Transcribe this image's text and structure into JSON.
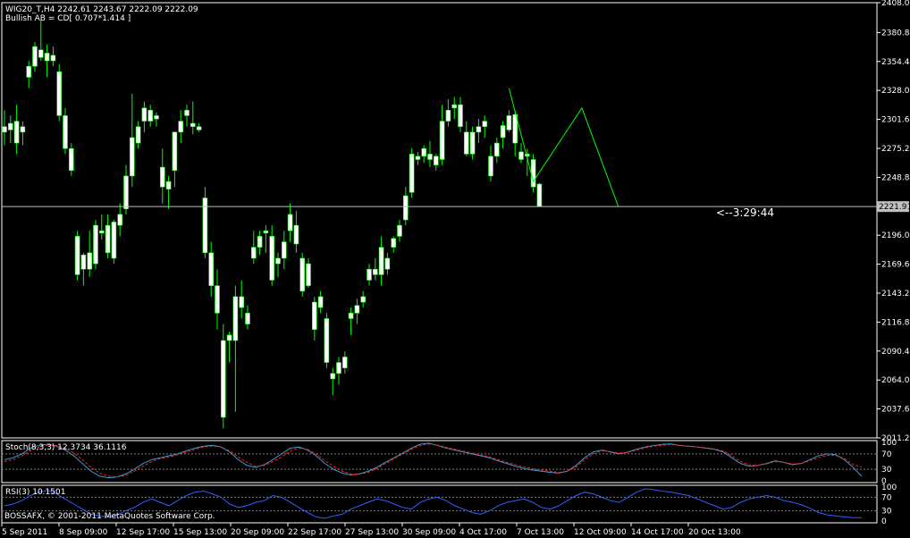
{
  "header": {
    "title": "WIG20_T,H4  2242.61 2243.67 2222.09 2222.09",
    "pattern": "Bullish AB = CD[ 0.707*1.414 ]"
  },
  "countdown": "<--3:29:44",
  "current_price_label": "2221.91",
  "copyright": "BOSSAFX, © 2001-2011 MetaQuotes Software Corp.",
  "colors": {
    "bull": "#ffffff",
    "bear": "#ffffff",
    "wick": "#00ff00",
    "zigzag": "#00ff00",
    "stoch_main": "#3b9bd6",
    "stoch_signal": "#ff2020",
    "rsi": "#3060ff",
    "grid": "#c0c0c0",
    "bg": "#000000"
  },
  "chart_data": [
    {
      "type": "candlestick",
      "title": "WIG20_T,H4",
      "y_ticks": [
        "2408.00",
        "2380.80",
        "2354.40",
        "2328.00",
        "2301.60",
        "2275.20",
        "2248.80",
        "2222.40",
        "2196.00",
        "2169.60",
        "2143.20",
        "2116.80",
        "2090.40",
        "2064.00",
        "2037.60",
        "2011.20"
      ],
      "x_ticks": [
        "5 Sep 2011",
        "8 Sep 09:00",
        "12 Sep 17:00",
        "15 Sep 13:00",
        "20 Sep 09:00",
        "22 Sep 17:00",
        "27 Sep 13:00",
        "30 Sep 09:00",
        "4 Oct 17:00",
        "7 Oct 13:00",
        "12 Oct 09:00",
        "14 Oct 17:00",
        "20 Oct 13:00"
      ],
      "ylim": [
        2011.2,
        2408
      ],
      "current_price": 2222.09,
      "ohlc": [
        [
          2295,
          2310,
          2278,
          2290
        ],
        [
          2292,
          2305,
          2280,
          2298
        ],
        [
          2300,
          2315,
          2270,
          2280
        ],
        [
          2290,
          2300,
          2278,
          2295
        ],
        [
          2340,
          2355,
          2330,
          2350
        ],
        [
          2350,
          2372,
          2345,
          2368
        ],
        [
          2365,
          2392,
          2355,
          2358
        ],
        [
          2355,
          2370,
          2340,
          2362
        ],
        [
          2360,
          2368,
          2350,
          2355
        ],
        [
          2345,
          2352,
          2300,
          2305
        ],
        [
          2305,
          2312,
          2270,
          2275
        ],
        [
          2275,
          2280,
          2250,
          2255
        ],
        [
          2195,
          2200,
          2155,
          2160
        ],
        [
          2165,
          2180,
          2150,
          2178
        ],
        [
          2180,
          2200,
          2158,
          2165
        ],
        [
          2170,
          2210,
          2165,
          2205
        ],
        [
          2198,
          2215,
          2192,
          2200
        ],
        [
          2205,
          2215,
          2175,
          2180
        ],
        [
          2175,
          2210,
          2170,
          2208
        ],
        [
          2205,
          2225,
          2195,
          2215
        ],
        [
          2220,
          2260,
          2215,
          2250
        ],
        [
          2250,
          2325,
          2240,
          2285
        ],
        [
          2280,
          2300,
          2275,
          2295
        ],
        [
          2300,
          2318,
          2290,
          2312
        ],
        [
          2310,
          2315,
          2295,
          2300
        ],
        [
          2302,
          2308,
          2295,
          2305
        ],
        [
          2258,
          2275,
          2225,
          2240
        ],
        [
          2238,
          2250,
          2220,
          2245
        ],
        [
          2255,
          2280,
          2240,
          2290
        ],
        [
          2290,
          2310,
          2280,
          2300
        ],
        [
          2305,
          2315,
          2295,
          2310
        ],
        [
          2298,
          2318,
          2288,
          2295
        ],
        [
          2295,
          2298,
          2290,
          2292
        ],
        [
          2230,
          2240,
          2175,
          2180
        ],
        [
          2180,
          2190,
          2140,
          2150
        ],
        [
          2150,
          2165,
          2110,
          2125
        ],
        [
          2100,
          2115,
          2020,
          2030
        ],
        [
          2100,
          2108,
          2080,
          2105
        ],
        [
          2100,
          2150,
          2035,
          2140
        ],
        [
          2140,
          2155,
          2120,
          2130
        ],
        [
          2125,
          2132,
          2110,
          2115
        ],
        [
          2175,
          2200,
          2170,
          2185
        ],
        [
          2185,
          2200,
          2178,
          2195
        ],
        [
          2198,
          2205,
          2180,
          2200
        ],
        [
          2195,
          2205,
          2150,
          2155
        ],
        [
          2175,
          2180,
          2158,
          2170
        ],
        [
          2175,
          2200,
          2165,
          2190
        ],
        [
          2200,
          2225,
          2190,
          2215
        ],
        [
          2205,
          2218,
          2180,
          2188
        ],
        [
          2175,
          2180,
          2140,
          2145
        ],
        [
          2150,
          2175,
          2148,
          2170
        ],
        [
          2135,
          2140,
          2100,
          2110
        ],
        [
          2140,
          2145,
          2125,
          2130
        ],
        [
          2120,
          2125,
          2075,
          2080
        ],
        [
          2070,
          2075,
          2050,
          2065
        ],
        [
          2080,
          2085,
          2060,
          2070
        ],
        [
          2075,
          2090,
          2070,
          2085
        ],
        [
          2120,
          2130,
          2105,
          2125
        ],
        [
          2125,
          2138,
          2115,
          2132
        ],
        [
          2135,
          2145,
          2130,
          2140
        ],
        [
          2155,
          2170,
          2150,
          2165
        ],
        [
          2165,
          2175,
          2155,
          2160
        ],
        [
          2185,
          2195,
          2150,
          2160
        ],
        [
          2165,
          2180,
          2160,
          2175
        ],
        [
          2185,
          2195,
          2180,
          2193
        ],
        [
          2195,
          2210,
          2190,
          2205
        ],
        [
          2210,
          2240,
          2205,
          2232
        ],
        [
          2235,
          2275,
          2230,
          2270
        ],
        [
          2265,
          2272,
          2260,
          2268
        ],
        [
          2268,
          2278,
          2262,
          2275
        ],
        [
          2270,
          2282,
          2258,
          2265
        ],
        [
          2260,
          2270,
          2255,
          2268
        ],
        [
          2265,
          2315,
          2260,
          2300
        ],
        [
          2300,
          2320,
          2295,
          2310
        ],
        [
          2312,
          2322,
          2302,
          2315
        ],
        [
          2315,
          2322,
          2290,
          2295
        ],
        [
          2290,
          2300,
          2268,
          2270
        ],
        [
          2270,
          2295,
          2265,
          2290
        ],
        [
          2290,
          2302,
          2280,
          2295
        ],
        [
          2295,
          2305,
          2285,
          2300
        ],
        [
          2268,
          2278,
          2245,
          2250
        ],
        [
          2268,
          2285,
          2262,
          2280
        ],
        [
          2285,
          2300,
          2275,
          2296
        ],
        [
          2292,
          2310,
          2290,
          2305
        ],
        [
          2306,
          2310,
          2268,
          2280
        ],
        [
          2272,
          2280,
          2262,
          2265
        ],
        [
          2268,
          2275,
          2250,
          2270
        ],
        [
          2265,
          2270,
          2235,
          2240
        ],
        [
          2242.61,
          2243.67,
          2222.09,
          2222.09
        ]
      ],
      "zigzag": [
        [
          83,
          2330
        ],
        [
          87,
          2245
        ],
        [
          95,
          2312
        ],
        [
          101,
          2222
        ]
      ]
    },
    {
      "type": "line",
      "title": "Stoch(8,3,3) 12.3734 36.1116",
      "y_ticks": [
        "100",
        "70",
        "30",
        "0"
      ],
      "ylim": [
        0,
        100
      ],
      "series": [
        {
          "name": "main",
          "values": [
            55,
            60,
            70,
            85,
            92,
            95,
            90,
            80,
            65,
            45,
            25,
            12,
            8,
            10,
            18,
            30,
            45,
            55,
            60,
            65,
            70,
            78,
            85,
            90,
            92,
            88,
            75,
            55,
            40,
            35,
            42,
            55,
            70,
            85,
            88,
            80,
            65,
            45,
            30,
            20,
            15,
            18,
            25,
            35,
            48,
            60,
            72,
            85,
            95,
            98,
            92,
            85,
            80,
            75,
            70,
            65,
            60,
            52,
            45,
            38,
            32,
            28,
            25,
            22,
            20,
            25,
            40,
            60,
            75,
            80,
            75,
            70,
            75,
            82,
            88,
            92,
            95,
            96,
            92,
            90,
            88,
            85,
            82,
            75,
            60,
            45,
            38,
            40,
            45,
            52,
            48,
            42,
            45,
            55,
            65,
            70,
            68,
            55,
            35,
            12
          ]
        },
        {
          "name": "signal",
          "values": [
            50,
            55,
            65,
            78,
            88,
            93,
            92,
            85,
            72,
            55,
            35,
            20,
            12,
            10,
            14,
            25,
            38,
            50,
            58,
            62,
            68,
            75,
            82,
            88,
            90,
            88,
            78,
            62,
            48,
            38,
            40,
            50,
            62,
            78,
            85,
            82,
            70,
            52,
            38,
            25,
            18,
            17,
            22,
            32,
            45,
            58,
            70,
            82,
            92,
            96,
            93,
            87,
            82,
            77,
            72,
            67,
            62,
            55,
            48,
            42,
            36,
            31,
            28,
            25,
            22,
            25,
            36,
            55,
            70,
            78,
            76,
            72,
            74,
            80,
            86,
            90,
            93,
            94,
            92,
            90,
            88,
            86,
            83,
            78,
            65,
            50,
            42,
            40,
            44,
            50,
            48,
            44,
            45,
            52,
            60,
            66,
            66,
            58,
            42,
            36
          ]
        }
      ]
    },
    {
      "type": "line",
      "title": "RSI(3) 10.1501",
      "y_ticks": [
        "100",
        "70",
        "30",
        "0"
      ],
      "ylim": [
        0,
        100
      ],
      "series": [
        {
          "name": "RSI(3)",
          "values": [
            45,
            50,
            60,
            75,
            85,
            90,
            80,
            65,
            50,
            35,
            20,
            15,
            12,
            18,
            30,
            40,
            55,
            65,
            55,
            45,
            60,
            75,
            85,
            88,
            80,
            70,
            50,
            40,
            45,
            55,
            60,
            75,
            70,
            55,
            40,
            25,
            12,
            8,
            15,
            20,
            35,
            45,
            55,
            65,
            60,
            50,
            40,
            35,
            55,
            65,
            70,
            60,
            45,
            35,
            25,
            20,
            30,
            45,
            55,
            60,
            65,
            55,
            40,
            35,
            45,
            60,
            75,
            85,
            80,
            70,
            60,
            55,
            70,
            85,
            95,
            92,
            88,
            85,
            80,
            75,
            65,
            55,
            45,
            35,
            40,
            55,
            65,
            70,
            75,
            70,
            60,
            55,
            48,
            38,
            25,
            18,
            15,
            12,
            10,
            10
          ]
        }
      ]
    }
  ]
}
